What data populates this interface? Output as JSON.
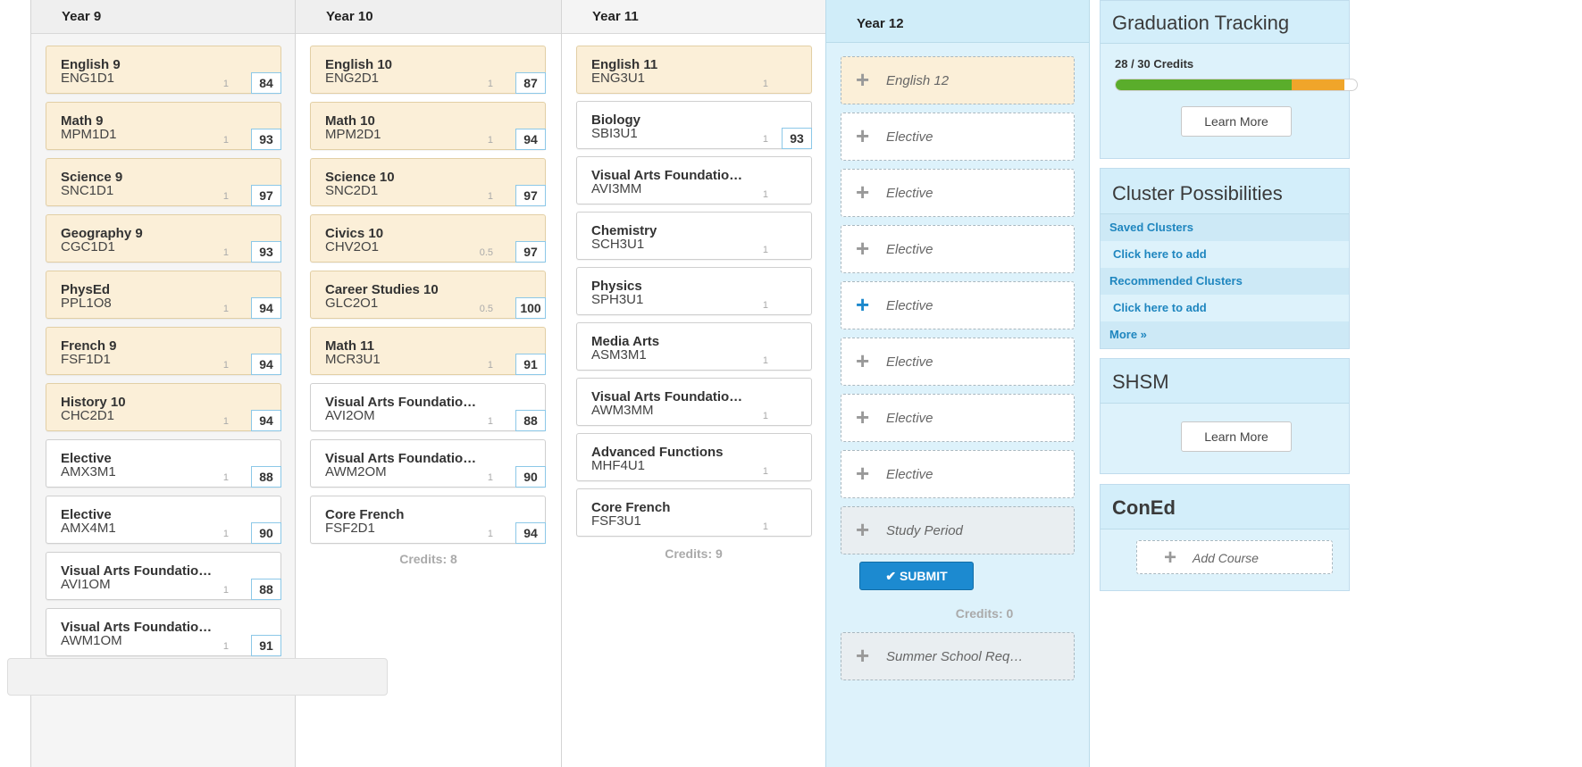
{
  "years": {
    "y9": {
      "title": "Year 9",
      "courses": [
        {
          "name": "English 9",
          "code": "ENG1D1",
          "credit": "1",
          "grade": "84",
          "status": "complete"
        },
        {
          "name": "Math 9",
          "code": "MPM1D1",
          "credit": "1",
          "grade": "93",
          "status": "complete"
        },
        {
          "name": "Science 9",
          "code": "SNC1D1",
          "credit": "1",
          "grade": "97",
          "status": "complete"
        },
        {
          "name": "Geography 9",
          "code": "CGC1D1",
          "credit": "1",
          "grade": "93",
          "status": "complete"
        },
        {
          "name": "PhysEd",
          "code": "PPL1O8",
          "credit": "1",
          "grade": "94",
          "status": "complete"
        },
        {
          "name": "French 9",
          "code": "FSF1D1",
          "credit": "1",
          "grade": "94",
          "status": "complete"
        },
        {
          "name": "History 10",
          "code": "CHC2D1",
          "credit": "1",
          "grade": "94",
          "status": "complete"
        },
        {
          "name": "Elective",
          "code": "AMX3M1",
          "credit": "1",
          "grade": "88",
          "status": "elective"
        },
        {
          "name": "Elective",
          "code": "AMX4M1",
          "credit": "1",
          "grade": "90",
          "status": "elective"
        },
        {
          "name": "Visual Arts Foundatio…",
          "code": "AVI1OM",
          "credit": "1",
          "grade": "88",
          "status": "elective"
        },
        {
          "name": "Visual Arts Foundatio…",
          "code": "AWM1OM",
          "credit": "1",
          "grade": "91",
          "status": "elective"
        }
      ]
    },
    "y10": {
      "title": "Year 10",
      "credits_label": "Credits: 8",
      "courses": [
        {
          "name": "English 10",
          "code": "ENG2D1",
          "credit": "1",
          "grade": "87",
          "status": "complete"
        },
        {
          "name": "Math 10",
          "code": "MPM2D1",
          "credit": "1",
          "grade": "94",
          "status": "complete"
        },
        {
          "name": "Science 10",
          "code": "SNC2D1",
          "credit": "1",
          "grade": "97",
          "status": "complete"
        },
        {
          "name": "Civics 10",
          "code": "CHV2O1",
          "credit": "0.5",
          "grade": "97",
          "status": "complete"
        },
        {
          "name": "Career Studies 10",
          "code": "GLC2O1",
          "credit": "0.5",
          "grade": "100",
          "status": "complete"
        },
        {
          "name": "Math 11",
          "code": "MCR3U1",
          "credit": "1",
          "grade": "91",
          "status": "complete"
        },
        {
          "name": "Visual Arts Foundatio…",
          "code": "AVI2OM",
          "credit": "1",
          "grade": "88",
          "status": "elective"
        },
        {
          "name": "Visual Arts Foundatio…",
          "code": "AWM2OM",
          "credit": "1",
          "grade": "90",
          "status": "elective"
        },
        {
          "name": "Core French",
          "code": "FSF2D1",
          "credit": "1",
          "grade": "94",
          "status": "elective"
        }
      ]
    },
    "y11": {
      "title": "Year 11",
      "credits_label": "Credits: 9",
      "courses": [
        {
          "name": "English 11",
          "code": "ENG3U1",
          "credit": "1",
          "grade": "",
          "status": "complete"
        },
        {
          "name": "Biology",
          "code": "SBI3U1",
          "credit": "1",
          "grade": "93",
          "status": "elective"
        },
        {
          "name": "Visual Arts Foundatio…",
          "code": "AVI3MM",
          "credit": "1",
          "grade": "",
          "status": "elective"
        },
        {
          "name": "Chemistry",
          "code": "SCH3U1",
          "credit": "1",
          "grade": "",
          "status": "elective"
        },
        {
          "name": "Physics",
          "code": "SPH3U1",
          "credit": "1",
          "grade": "",
          "status": "elective"
        },
        {
          "name": "Media Arts",
          "code": "ASM3M1",
          "credit": "1",
          "grade": "",
          "status": "elective"
        },
        {
          "name": "Visual Arts Foundatio…",
          "code": "AWM3MM",
          "credit": "1",
          "grade": "",
          "status": "elective"
        },
        {
          "name": "Advanced Functions",
          "code": "MHF4U1",
          "credit": "1",
          "grade": "",
          "status": "elective"
        },
        {
          "name": "Core French",
          "code": "FSF3U1",
          "credit": "1",
          "grade": "",
          "status": "elective"
        }
      ]
    },
    "y12": {
      "title": "Year 12",
      "slots": [
        {
          "label": "English 12",
          "kind": "eng"
        },
        {
          "label": "Elective",
          "kind": "elective"
        },
        {
          "label": "Elective",
          "kind": "elective"
        },
        {
          "label": "Elective",
          "kind": "elective"
        },
        {
          "label": "Elective",
          "kind": "elective-active"
        },
        {
          "label": "Elective",
          "kind": "elective"
        },
        {
          "label": "Elective",
          "kind": "elective"
        },
        {
          "label": "Elective",
          "kind": "elective"
        },
        {
          "label": "Study Period",
          "kind": "study"
        }
      ],
      "submit_label": "SUBMIT",
      "credits_label": "Credits: 0",
      "summer_label": "Summer School Req…"
    }
  },
  "graduation": {
    "title": "Graduation Tracking",
    "credits_text": "28 / 30 Credits",
    "progress_earned_fraction": 0.73,
    "progress_planned_fraction": 0.22,
    "learn_more": "Learn More"
  },
  "clusters": {
    "title": "Cluster Possibilities",
    "saved_label": "Saved Clusters",
    "saved_add": "Click here to add",
    "recommended_label": "Recommended Clusters",
    "recommended_add": "Click here to add",
    "more_label": "More »"
  },
  "shsm": {
    "title": "SHSM",
    "learn_more": "Learn More"
  },
  "coned": {
    "title": "ConEd",
    "add_label": "Add Course"
  },
  "colors": {
    "complete_bg": "#fbefd8",
    "accent_blue": "#1c88cc",
    "progress_green": "#5aad2b",
    "progress_orange": "#f0a52a"
  }
}
